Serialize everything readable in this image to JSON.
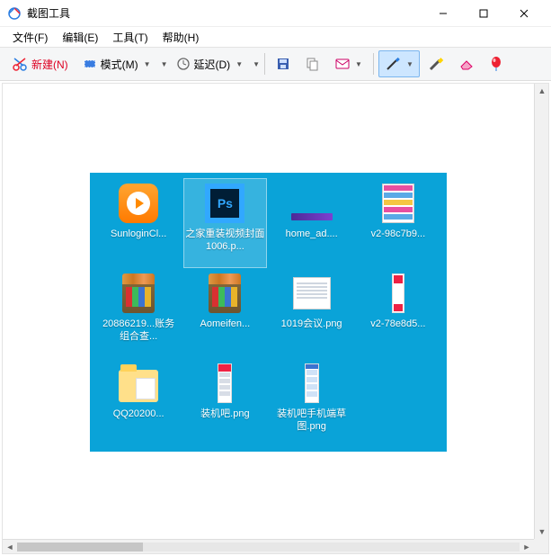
{
  "app": {
    "title": "截图工具"
  },
  "menus": {
    "file": "文件(F)",
    "edit": "编辑(E)",
    "tools": "工具(T)",
    "help": "帮助(H)"
  },
  "toolbar": {
    "new_label": "新建(N)",
    "mode_label": "模式(M)",
    "delay_label": "延迟(D)"
  },
  "desktop": {
    "items": [
      {
        "label": "SunloginCl...",
        "kind": "orange-app",
        "selected": false
      },
      {
        "label": "之家重装视频封面1006.p...",
        "kind": "ps",
        "selected": true
      },
      {
        "label": "home_ad....",
        "kind": "purple-bar",
        "selected": false
      },
      {
        "label": "v2-98c7b9...",
        "kind": "doc-sheet",
        "selected": false
      },
      {
        "label": "20886219...账务组合查...",
        "kind": "rar",
        "selected": false
      },
      {
        "label": "Aomeifen...",
        "kind": "rar",
        "selected": false
      },
      {
        "label": "1019会议.png",
        "kind": "white-doc",
        "selected": false
      },
      {
        "label": "v2-78e8d5...",
        "kind": "narrow-img",
        "selected": false
      },
      {
        "label": "QQ20200...",
        "kind": "folder",
        "selected": false
      },
      {
        "label": "装机吧.png",
        "kind": "phone-shot",
        "selected": false
      },
      {
        "label": "装机吧手机端草图.png",
        "kind": "web-shot",
        "selected": false
      }
    ]
  }
}
